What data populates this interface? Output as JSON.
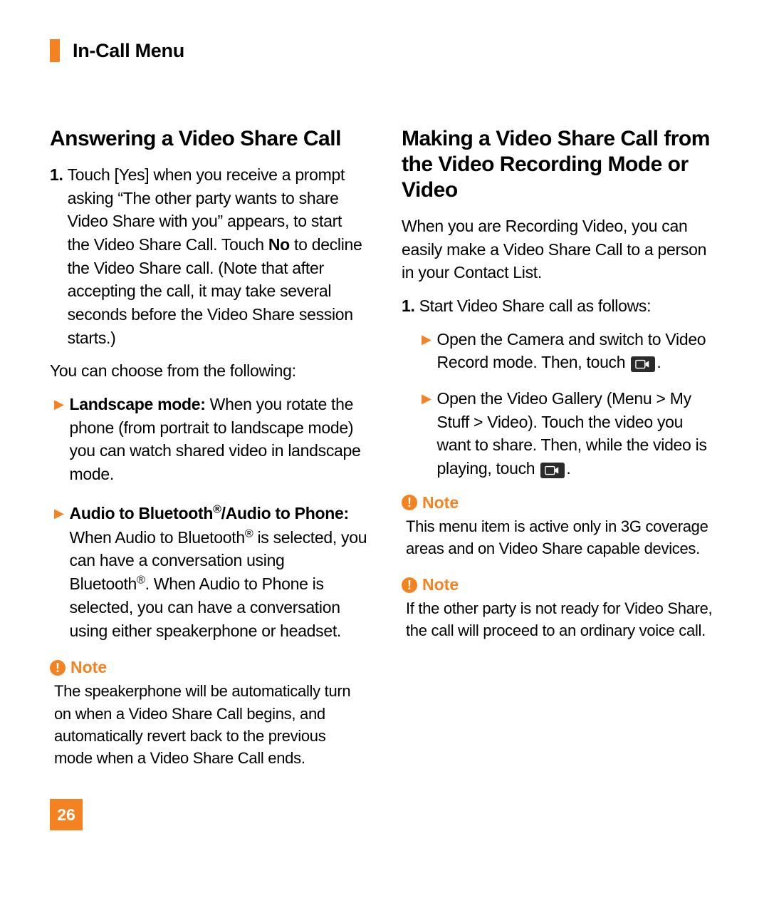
{
  "header": {
    "title": "In-Call Menu"
  },
  "left": {
    "heading": "Answering a Video Share Call",
    "step1_num": "1.",
    "step1_a": "Touch [Yes] when you receive a prompt asking “The other party wants to share Video Share with you” appears, to start the Video Share Call. Touch ",
    "step1_bold": "No",
    "step1_b": " to decline the Video Share call. (Note that after accepting the call, it may take several seconds before the Video Share session starts.)",
    "choose": "You can choose from the following:",
    "b1_bold": "Landscape mode:",
    "b1_rest": " When you rotate the phone (from portrait to landscape mode) you can watch shared video in landscape mode.",
    "b2_bold": "Audio to Bluetooth®/Audio to Phone:",
    "b2_rest": " When Audio to Bluetooth® is selected, you can have a conversation using Bluetooth®. When Audio to Phone is selected, you can have a conversation using either speakerphone or headset.",
    "note_label": "Note",
    "note_text": "The speakerphone will be automatically turn on when a Video Share Call begins, and automatically revert back to the previous mode when a Video Share Call ends."
  },
  "right": {
    "heading": "Making a Video Share Call from the Video Recording Mode or Video",
    "intro": "When you are Recording Video, you can easily make a Video Share Call to a person in your Contact List.",
    "step1_num": "1.",
    "step1_text": "Start Video Share call as follows:",
    "sb1_a": "Open the Camera and switch to Video Record mode. Then, touch ",
    "sb1_b": ".",
    "sb2_a": "Open the Video Gallery (Menu > My Stuff > Video). Touch the video you want to share. Then, while the video is playing, touch ",
    "sb2_b": ".",
    "note1_label": "Note",
    "note1_text": "This menu item is active only in 3G coverage areas and on Video Share capable devices.",
    "note2_label": "Note",
    "note2_text": "If the other party is not ready for Video Share, the call will proceed to an ordinary voice call."
  },
  "page_number": "26"
}
